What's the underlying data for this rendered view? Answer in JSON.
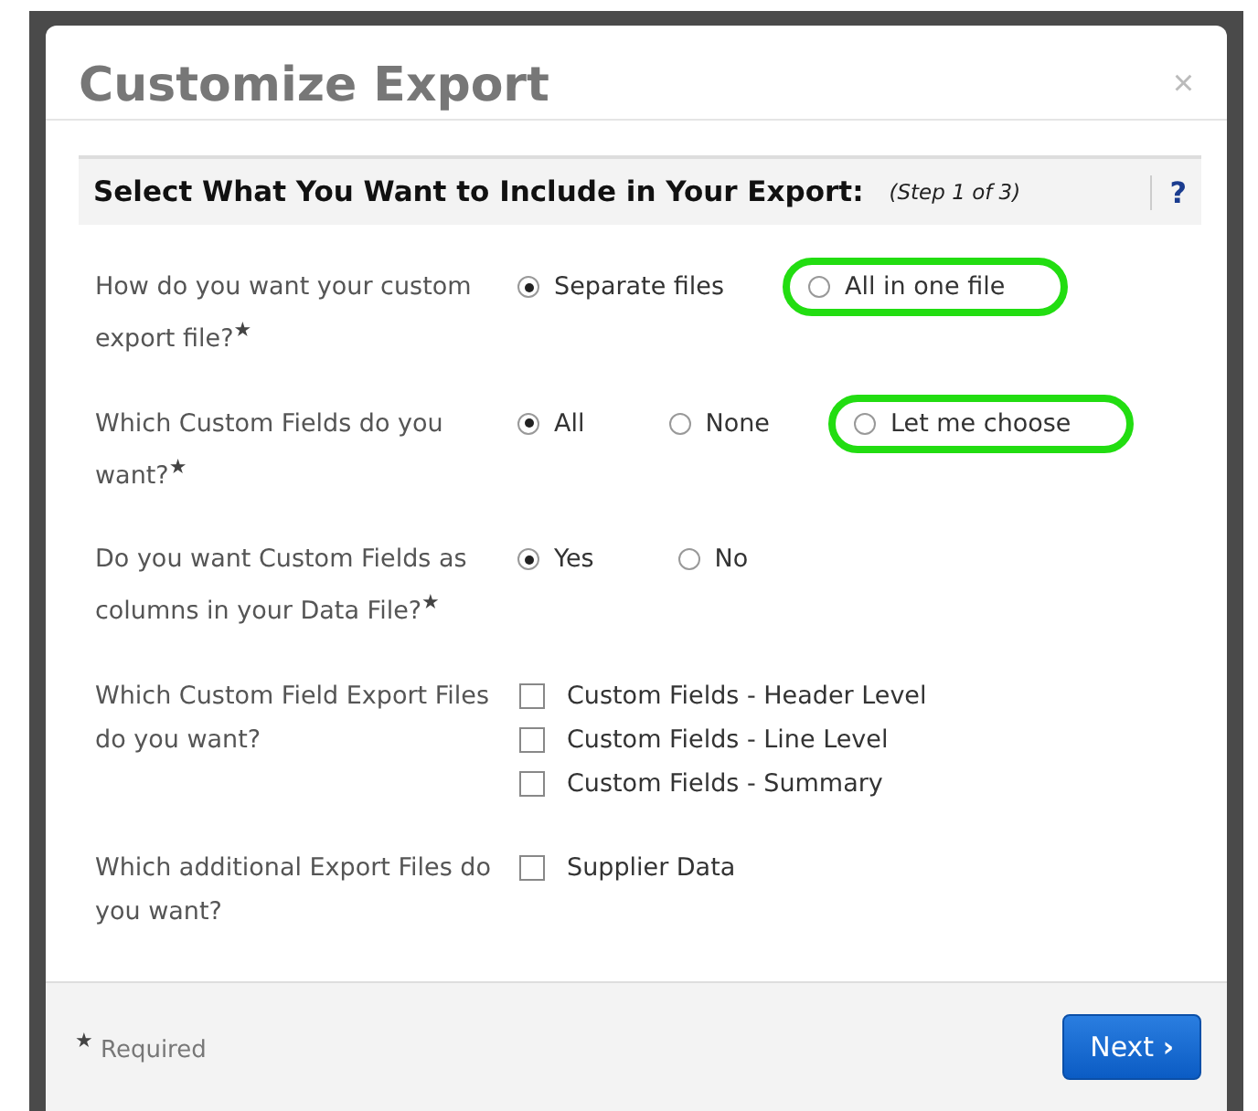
{
  "dialog": {
    "title": "Customize Export",
    "close": "×"
  },
  "section": {
    "heading": "Select What You Want to Include in Your Export:",
    "step": "(Step 1 of 3)",
    "help": "?"
  },
  "questions": [
    {
      "label": "How do you want your custom export file?",
      "mark": "★",
      "kind": "radio",
      "options": [
        {
          "label": "Separate files",
          "selected": true,
          "highlighted": false
        },
        {
          "label": "All in one file",
          "selected": false,
          "highlighted": true
        }
      ]
    },
    {
      "label": "Which Custom Fields do you want?",
      "mark": "★",
      "kind": "radio",
      "options": [
        {
          "label": "All",
          "selected": true,
          "highlighted": false
        },
        {
          "label": "None",
          "selected": false,
          "highlighted": false
        },
        {
          "label": "Let me choose",
          "selected": false,
          "highlighted": true
        }
      ]
    },
    {
      "label": "Do you want Custom Fields as columns in your Data File?",
      "mark": "★",
      "kind": "radio",
      "options": [
        {
          "label": "Yes",
          "selected": true,
          "highlighted": false
        },
        {
          "label": "No",
          "selected": false,
          "highlighted": false
        }
      ]
    },
    {
      "label": "Which Custom Field Export Files do you want?",
      "kind": "checkbox",
      "options": [
        {
          "label": "Custom Fields - Header Level",
          "checked": false
        },
        {
          "label": "Custom Fields - Line Level",
          "checked": false
        },
        {
          "label": "Custom Fields - Summary",
          "checked": false
        }
      ]
    },
    {
      "label": "Which additional Export Files do you want?",
      "kind": "checkbox",
      "options": [
        {
          "label": "Supplier Data",
          "checked": false
        }
      ]
    }
  ],
  "footer": {
    "mark": "★",
    "required": "Required",
    "next": "Next",
    "next_arrow": "›"
  }
}
